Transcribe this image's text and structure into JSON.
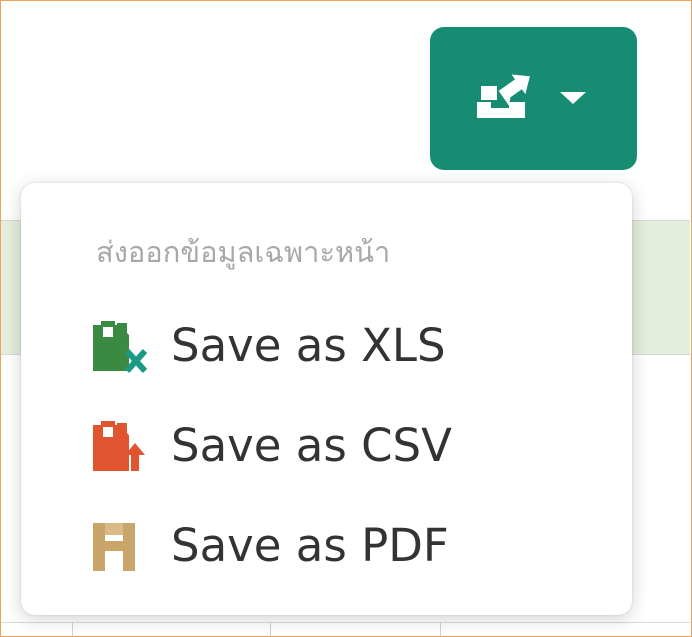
{
  "export_button": {
    "icon": "export-icon",
    "caret_icon": "caret-down-icon",
    "color": "#168d73"
  },
  "dropdown": {
    "header": "ส่งออกข้อมูลเฉพาะหน้า",
    "items": [
      {
        "label": "Save as XLS",
        "icon": "xls-file-icon",
        "color": "#3b8a42"
      },
      {
        "label": "Save as CSV",
        "icon": "csv-file-icon",
        "color": "#e0552f"
      },
      {
        "label": "Save as PDF",
        "icon": "pdf-file-icon",
        "color": "#c9a56a"
      }
    ]
  },
  "background": {
    "accent": "#f0a15a",
    "header_strip": "#e4eedc"
  }
}
